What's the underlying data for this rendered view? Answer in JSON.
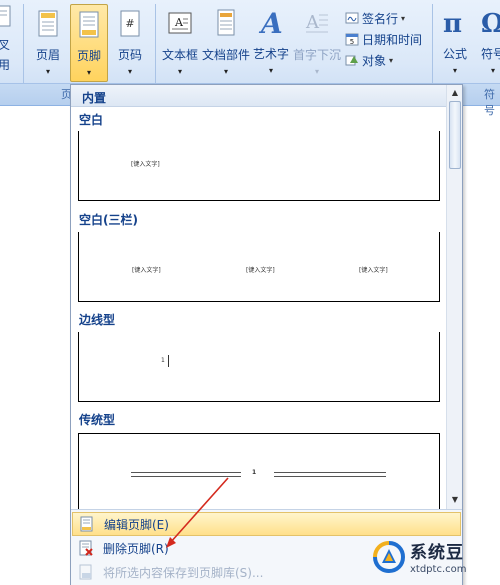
{
  "ribbon": {
    "left_partial_label_1": "叉",
    "left_partial_label_2": "用",
    "header_label": "页眉",
    "footer_label": "页脚",
    "page_number_label": "页码",
    "textbox_label": "文本框",
    "quickparts_label": "文档部件",
    "wordart_label": "艺术字",
    "dropcap_label": "首字下沉",
    "signature_label": "签名行",
    "datetime_label": "日期和时间",
    "object_label": "对象",
    "equation_label": "公式",
    "symbol_label": "符号",
    "group_label_partial": "页",
    "group_label_symbols": "符号"
  },
  "gallery": {
    "header": "内置",
    "sections": [
      {
        "title": "空白",
        "placeholder": "[键入文字]"
      },
      {
        "title": "空白(三栏)",
        "placeholders": [
          "[键入文字]",
          "[键入文字]",
          "[键入文字]"
        ]
      },
      {
        "title": "边线型",
        "page_number": "1"
      },
      {
        "title": "传统型",
        "page_number": "1"
      }
    ]
  },
  "menu": {
    "edit_footer": "编辑页脚(E)",
    "delete_footer": "删除页脚(R)",
    "save_selection": "将所选内容保存到页脚库(S)..."
  },
  "watermark": {
    "name": "系统豆",
    "url": "xtdptc.com"
  },
  "colors": {
    "ribbon_text": "#15428b",
    "active_button": "#ffd35e",
    "arrow": "#d42a1e"
  }
}
